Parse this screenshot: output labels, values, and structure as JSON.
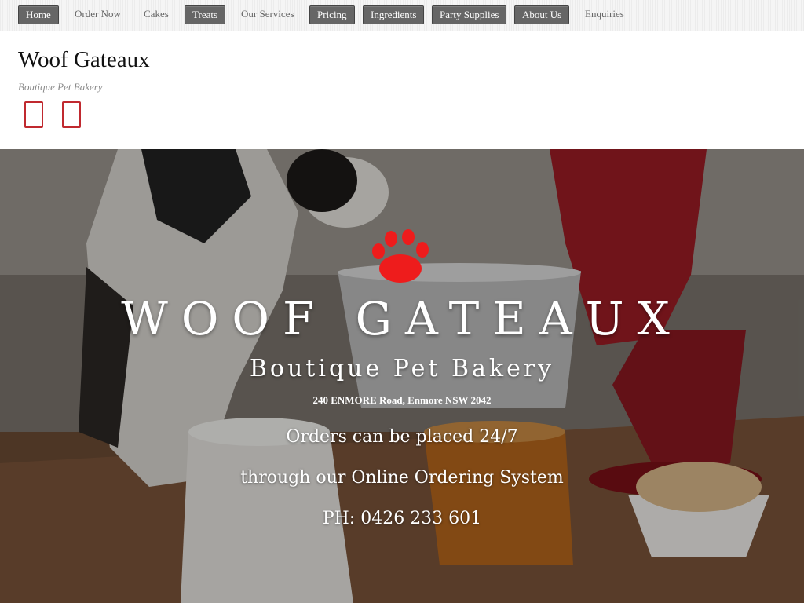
{
  "nav": {
    "items": [
      {
        "label": "Home",
        "style": "button"
      },
      {
        "label": "Order Now",
        "style": "text"
      },
      {
        "label": "Cakes",
        "style": "text"
      },
      {
        "label": "Treats",
        "style": "button"
      },
      {
        "label": "Our Services",
        "style": "text"
      },
      {
        "label": "Pricing",
        "style": "button"
      },
      {
        "label": "Ingredients",
        "style": "button"
      },
      {
        "label": "Party Supplies",
        "style": "button"
      },
      {
        "label": "About Us",
        "style": "button"
      },
      {
        "label": "Enquiries",
        "style": "text"
      }
    ]
  },
  "header": {
    "title": "Woof Gateaux",
    "tagline": "Boutique Pet Bakery",
    "social_icons": [
      "facebook-icon",
      "instagram-icon"
    ]
  },
  "hero": {
    "logo_icon": "paw-icon",
    "title": "WOOF GATEAUX",
    "subtitle": "Boutique Pet Bakery",
    "address": "240 ENMORE Road, Enmore NSW 2042",
    "line1": "Orders can be placed 24/7",
    "line2": "through our Online Ordering System",
    "phone": "PH: 0426 233 601"
  },
  "colors": {
    "accent": "#c0292f",
    "paw": "#ee1c1c",
    "nav_button": "#666666"
  }
}
